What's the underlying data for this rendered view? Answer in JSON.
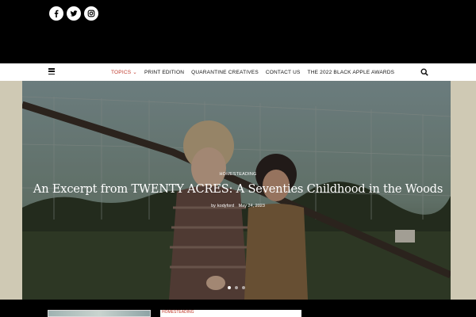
{
  "social": {
    "icons": [
      "facebook-icon",
      "twitter-icon",
      "instagram-icon"
    ],
    "colors": {
      "circle": "#ffffff",
      "glyph": "#000000"
    }
  },
  "nav": {
    "items": [
      {
        "label": "TOPICS ⌄",
        "active": true
      },
      {
        "label": "PRINT EDITION",
        "active": false
      },
      {
        "label": "QUARANTINE CREATIVES",
        "active": false
      },
      {
        "label": "CONTACT US",
        "active": false
      },
      {
        "label": "THE 2022 BLACK APPLE AWARDS",
        "active": false
      }
    ],
    "menu_icon": "hamburger-icon",
    "search_icon": "search-icon",
    "accent": "#c0392b"
  },
  "hero": {
    "category": "HOMESTEADING",
    "title": "An Excerpt from TWENTY ACRES: A Seventies Childhood in the Woods",
    "author_prefix": "by",
    "author": "kodyford",
    "date": "May 24, 2023",
    "slide_count": 3,
    "active_slide": 1
  },
  "below": {
    "card_category": "HOMESTEADING"
  }
}
